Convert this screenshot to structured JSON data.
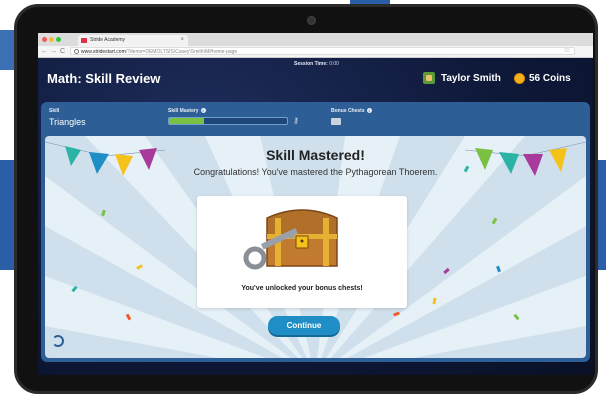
{
  "browser": {
    "tab_title": "Stride Academy",
    "tab_close": "×",
    "url_host": "www.stridestart.com",
    "url_path": "/?demo=DEMOLTSIS\\Casey\\Smith\\M#home-page",
    "nav_back": "←",
    "nav_forward": "→",
    "nav_reload": "C",
    "bookmark_icon": "star-icon"
  },
  "header": {
    "session_label": "Session Time:",
    "session_time": "0:00",
    "title": "Math: Skill Review",
    "user_name": "Taylor Smith",
    "coins": "56 Coins"
  },
  "skill_bar": {
    "skill_label": "Skill",
    "skill_value": "Triangles",
    "mastery_label": "Skill Mastery",
    "mastery_progress": 0.3,
    "bonus_label": "Bonus Chests"
  },
  "modal": {
    "heading": "Skill Mastered!",
    "subheading": "Congratulations! You've mastered the Pythagorean Thoerem.",
    "unlock_text": "You've unlocked your bonus chests!",
    "continue_label": "Continue"
  },
  "colors": {
    "accent": "#1f8ec6",
    "panel": "#2d5e95",
    "progress": "#7ac143"
  }
}
